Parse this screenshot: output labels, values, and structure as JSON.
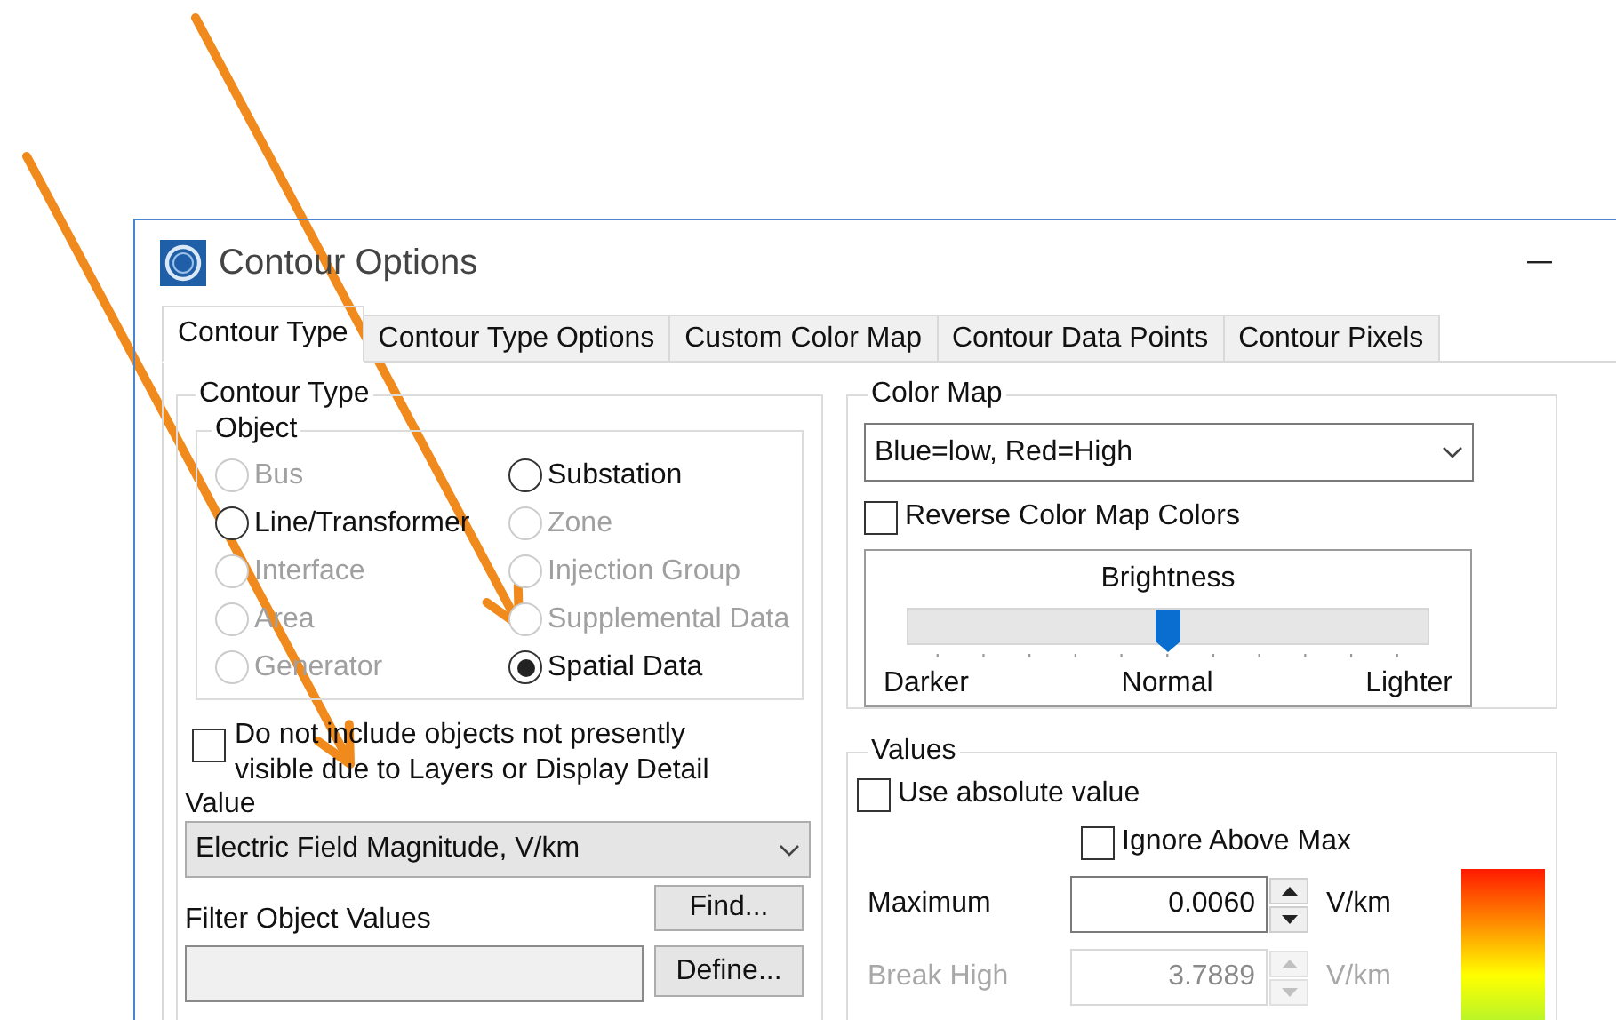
{
  "window": {
    "title": "Contour Options"
  },
  "tabs": [
    {
      "label": "Contour Type",
      "selected": true
    },
    {
      "label": "Contour Type Options",
      "selected": false
    },
    {
      "label": "Custom Color Map",
      "selected": false
    },
    {
      "label": "Contour Data Points",
      "selected": false
    },
    {
      "label": "Contour Pixels",
      "selected": false
    }
  ],
  "contour_type": {
    "title": "Contour Type",
    "object": {
      "title": "Object",
      "options": [
        {
          "label": "Bus",
          "selected": false,
          "disabled": true
        },
        {
          "label": "Substation",
          "selected": false,
          "disabled": false
        },
        {
          "label": "Line/Transformer",
          "selected": false,
          "disabled": false
        },
        {
          "label": "Zone",
          "selected": false,
          "disabled": true
        },
        {
          "label": "Interface",
          "selected": false,
          "disabled": true
        },
        {
          "label": "Injection Group",
          "selected": false,
          "disabled": true
        },
        {
          "label": "Area",
          "selected": false,
          "disabled": true
        },
        {
          "label": "Supplemental Data",
          "selected": false,
          "disabled": true
        },
        {
          "label": "Generator",
          "selected": false,
          "disabled": true
        },
        {
          "label": "Spatial Data",
          "selected": true,
          "disabled": false
        }
      ]
    },
    "exclude_hidden": {
      "label": "Do not include objects not presently visible due to Layers or Display Detail",
      "checked": false
    },
    "value": {
      "label": "Value",
      "selected": "Electric Field Magnitude, V/km"
    },
    "filter": {
      "label": "Filter Object Values",
      "find": "Find...",
      "define": "Define..."
    }
  },
  "color_map": {
    "title": "Color Map",
    "selected": "Blue=low, Red=High",
    "reverse": {
      "label": "Reverse Color Map Colors",
      "checked": false
    },
    "brightness": {
      "title": "Brightness",
      "level": 0.5,
      "labels": [
        "Darker",
        "Normal",
        "Lighter"
      ]
    }
  },
  "values": {
    "title": "Values",
    "use_absolute": {
      "label": "Use absolute value",
      "checked": false
    },
    "ignore_above_max": {
      "label": "Ignore Above Max",
      "checked": false
    },
    "rows": [
      {
        "label": "Maximum",
        "value": "0.0060",
        "unit": "V/km",
        "disabled": false
      },
      {
        "label": "Break High",
        "value": "3.7889",
        "unit": "V/km",
        "disabled": true
      }
    ]
  }
}
